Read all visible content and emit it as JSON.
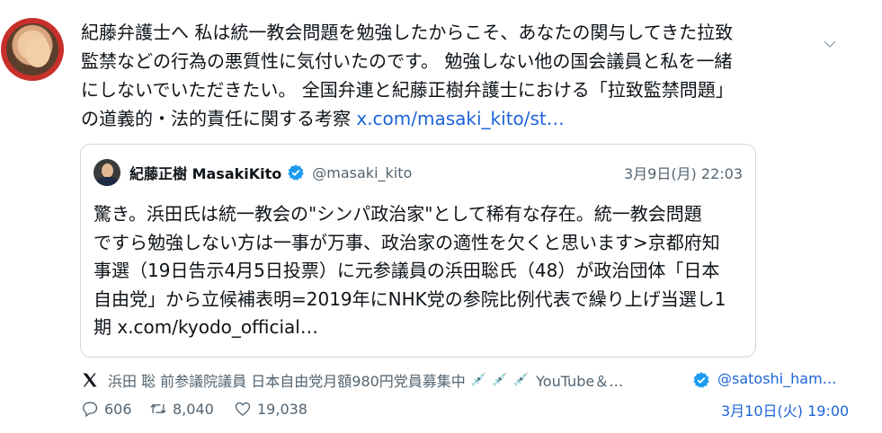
{
  "tweet": {
    "lines": [
      "紀藤弁護士へ 私は統一教会問題を勉強したからこそ、あなたの関与してきた拉致",
      "監禁などの行為の悪質性に気付いたのです。 勉強しない他の国会議員と私を一緒",
      "にしないでいただきたい。 全国弁連と紀藤正樹弁護士における「拉致監禁問題」",
      "の道義的・法的責任に関する考察 "
    ],
    "link": "x.com/masaki_kito/st…"
  },
  "quote": {
    "name": "紀藤正樹 MasakiKito",
    "handle": "@masaki_kito",
    "date": "3月9日(月) 22:03",
    "lines": [
      "驚き。浜田氏は統一教会の\"シンパ政治家\"として稀有な存在。統一教会問題",
      "ですら勉強しない方は一事が万事、政治家の適性を欠くと思います>京都府知",
      "事選（19日告示4月5日投票）に元参議員の浜田聡氏（48）が政治団体「日本",
      "自由党」から立候補表明=2019年にNHK党の参院比例代表で繰り上げ当選し1",
      "期 x.com/kyodo_official…"
    ]
  },
  "source": {
    "name": "浜田 聡 前参議院議員 日本自由党月額980円党員募集中",
    "syringes": [
      "💉",
      "💉",
      "💉"
    ],
    "rest": "YouTube＆…",
    "handle": "@satoshi_ham…"
  },
  "actions": {
    "replies": "606",
    "retweets": "8,040",
    "likes": "19,038",
    "time": "3月10日(火) 19:00"
  },
  "colors": {
    "link": "#1d64d8",
    "verified": "#1d9bf0",
    "muted": "#536471",
    "avatar_ring": "#c8302b"
  },
  "icons": [
    "chevron-down-icon",
    "verified-badge-icon",
    "x-logo-icon",
    "syringe-icon",
    "reply-icon",
    "retweet-icon",
    "like-icon"
  ]
}
